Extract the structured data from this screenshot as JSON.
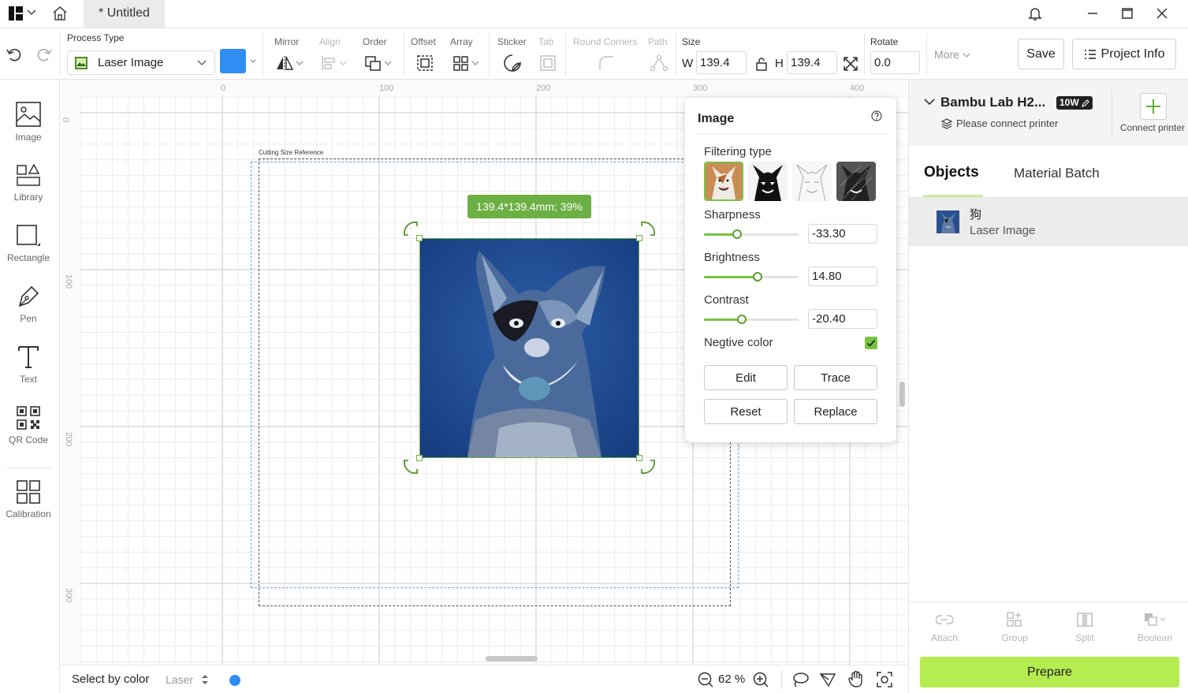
{
  "titlebar": {
    "tab_title": "* Untitled"
  },
  "toolbar": {
    "process_type_label": "Process Type",
    "process_type_value": "Laser Image",
    "color": "#2f8ef4",
    "mirror": "Mirror",
    "align": "Align",
    "order": "Order",
    "offset": "Offset",
    "array": "Array",
    "sticker": "Sticker",
    "tab": "Tab",
    "round_corners": "Round Corners",
    "path": "Path",
    "size_label": "Size",
    "w_label": "W",
    "w_value": "139.4",
    "h_label": "H",
    "h_value": "139.4",
    "rotate_label": "Rotate",
    "rotate_value": "0.0",
    "more": "More",
    "save": "Save",
    "project_info": "Project Info"
  },
  "sidebar": {
    "items": [
      {
        "label": "Image"
      },
      {
        "label": "Library"
      },
      {
        "label": "Rectangle"
      },
      {
        "label": "Pen"
      },
      {
        "label": "Text"
      },
      {
        "label": "QR Code"
      },
      {
        "label": "Calibration"
      }
    ]
  },
  "canvas": {
    "ruler_top": [
      "0",
      "100",
      "200",
      "300",
      "400"
    ],
    "ruler_left": [
      "0",
      "100",
      "200",
      "300"
    ],
    "cut_ref_label": "Cutting Size Reference",
    "dimension_badge": "139.4*139.4mm; 39%"
  },
  "image_panel": {
    "title": "Image",
    "filtering_type_label": "Filtering type",
    "sharpness_label": "Sharpness",
    "sharpness_value": "-33.30",
    "sharpness_level": 0.35,
    "brightness_label": "Brightness",
    "brightness_value": "14.80",
    "brightness_level": 0.57,
    "contrast_label": "Contrast",
    "contrast_value": "-20.40",
    "contrast_level": 0.4,
    "negative_color_label": "Negtive color",
    "negative_color_checked": true,
    "edit": "Edit",
    "trace": "Trace",
    "reset": "Reset",
    "replace": "Replace"
  },
  "bottombar": {
    "select_by_color": "Select by color",
    "laser": "Laser",
    "laser_color": "#2f8ef4",
    "zoom": "62 %"
  },
  "right_panel": {
    "printer_name": "Bambu Lab H2...",
    "power_badge": "10W",
    "connect_status": "Please connect printer",
    "connect_printer": "Connect printer",
    "tabs": [
      "Objects",
      "Material Batch"
    ],
    "object_name": "狗",
    "object_type": "Laser Image",
    "tools": [
      "Attach",
      "Group",
      "Split",
      "Boolean"
    ],
    "prepare": "Prepare",
    "accent_color": "#b5ec50"
  }
}
